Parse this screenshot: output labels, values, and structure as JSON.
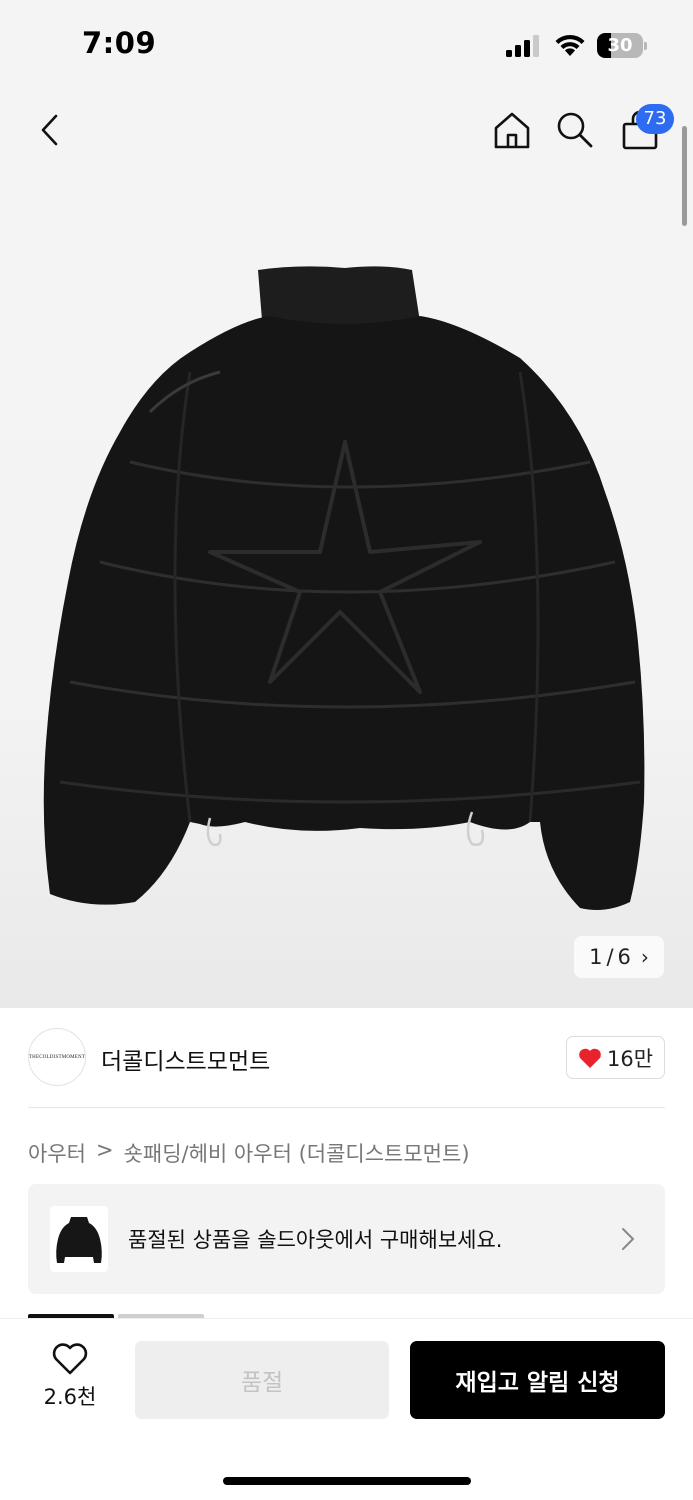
{
  "status_bar": {
    "time": "7:09",
    "battery_level": "30",
    "battery_fraction": 0.3
  },
  "nav": {
    "cart_count": "73",
    "icons": [
      "back-arrow-icon",
      "home-icon",
      "search-icon",
      "shopping-bag-icon"
    ]
  },
  "gallery": {
    "current": "1",
    "separator": "/",
    "total": "6",
    "next_glyph": "›"
  },
  "brand": {
    "logo_text": "THECOLDISTMOMENT",
    "name": "더콜디스트모먼트",
    "like_count": "16만"
  },
  "breadcrumb": {
    "category": "아우터",
    "separator": ">",
    "subcategory": "숏패딩/헤비 아우터 (더콜디스트모먼트)"
  },
  "soldout_banner": {
    "text": "품절된 상품을 솔드아웃에서 구매해보세요."
  },
  "bottom_bar": {
    "wish_count": "2.6천",
    "soldout_label": "품절",
    "restock_label": "재입고 알림 신청"
  },
  "colors": {
    "badge": "#2d6bf0",
    "heart": "#e8232c",
    "primary_button": "#000000",
    "disabled_button": "#eeeeee"
  }
}
